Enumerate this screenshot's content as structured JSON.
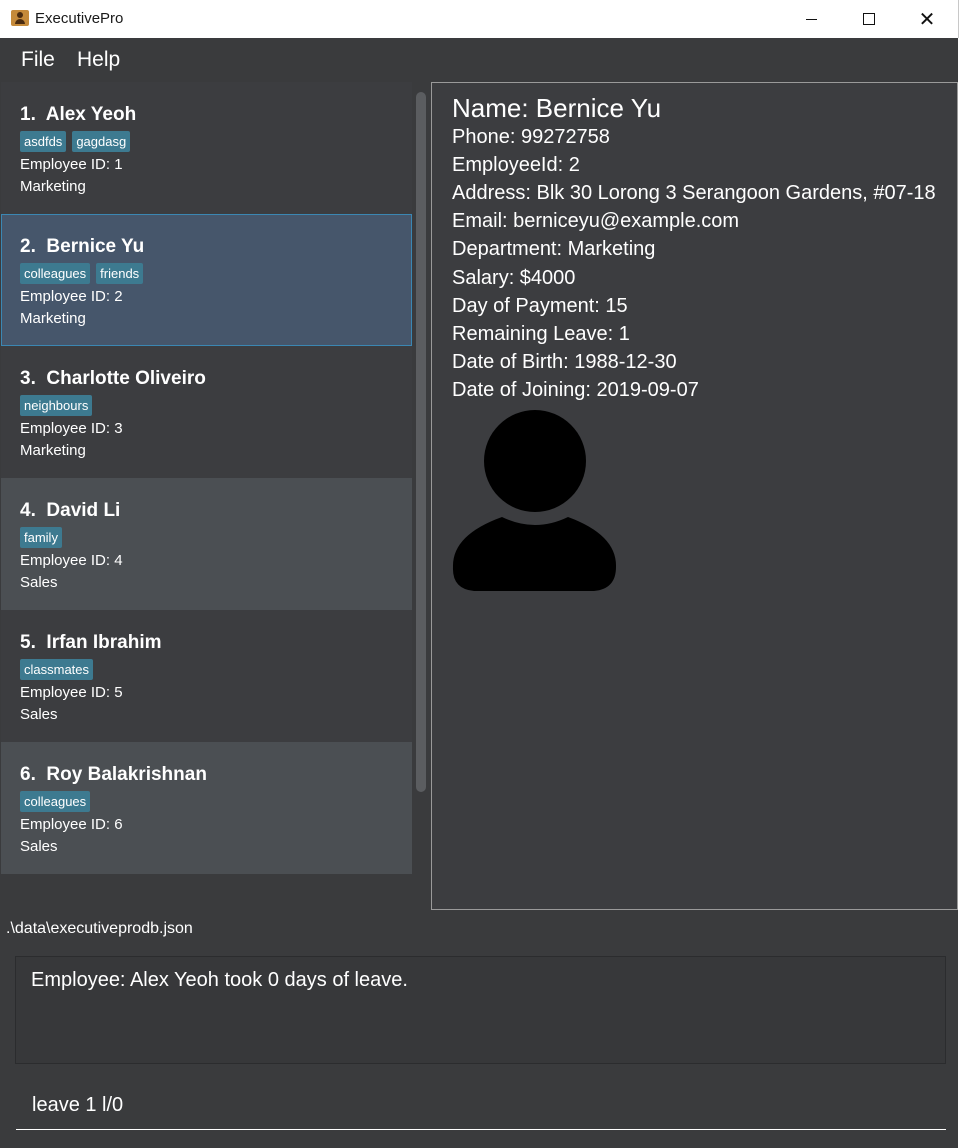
{
  "window": {
    "title": "ExecutivePro",
    "minimize_icon": "minimize-icon",
    "maximize_icon": "maximize-icon",
    "close_icon": "close-icon",
    "close_glyph": "✕"
  },
  "menu": {
    "file": "File",
    "help": "Help"
  },
  "employees": [
    {
      "index": "1.",
      "name": "Alex Yeoh",
      "tags": [
        "asdfds",
        "gagdasg"
      ],
      "employee_id": "Employee ID: 1",
      "department": "Marketing"
    },
    {
      "index": "2.",
      "name": "Bernice Yu",
      "tags": [
        "colleagues",
        "friends"
      ],
      "employee_id": "Employee ID: 2",
      "department": "Marketing"
    },
    {
      "index": "3.",
      "name": "Charlotte Oliveiro",
      "tags": [
        "neighbours"
      ],
      "employee_id": "Employee ID: 3",
      "department": "Marketing"
    },
    {
      "index": "4.",
      "name": "David Li",
      "tags": [
        "family"
      ],
      "employee_id": "Employee ID: 4",
      "department": "Sales"
    },
    {
      "index": "5.",
      "name": "Irfan Ibrahim",
      "tags": [
        "classmates"
      ],
      "employee_id": "Employee ID: 5",
      "department": "Sales"
    },
    {
      "index": "6.",
      "name": "Roy Balakrishnan",
      "tags": [
        "colleagues"
      ],
      "employee_id": "Employee ID: 6",
      "department": "Sales"
    }
  ],
  "selected_index": 1,
  "detail": {
    "name": "Name: Bernice Yu",
    "phone": "Phone: 99272758",
    "employee_id": "EmployeeId: 2",
    "address": "Address: Blk 30 Lorong 3 Serangoon Gardens, #07-18",
    "email": "Email: berniceyu@example.com",
    "department": "Department: Marketing",
    "salary": "Salary: $4000",
    "day_of_payment": "Day of Payment: 15",
    "remaining_leave": "Remaining Leave: 1",
    "date_of_birth": "Date of Birth: 1988-12-30",
    "date_of_joining": "Date of Joining: 2019-09-07",
    "avatar_icon": "person-avatar-icon"
  },
  "status": {
    "file_path": ".\\data\\executiveprodb.json"
  },
  "result": {
    "message": "Employee: Alex Yeoh took 0 days of leave."
  },
  "command": {
    "value": "leave 1 l/0"
  },
  "colors": {
    "background": "#3a3b3d",
    "tag": "#3d7a90",
    "selected_card": "#46566b",
    "selected_border": "#3b87b3",
    "alt_card": "#4b4f53"
  }
}
